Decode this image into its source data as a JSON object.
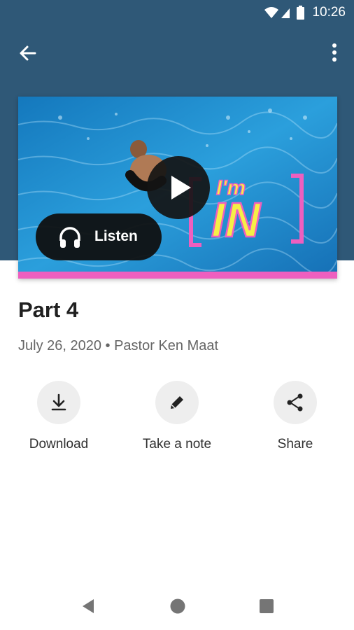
{
  "status_bar": {
    "time": "10:26"
  },
  "app_bar": {
    "back_icon": "arrow-left-icon",
    "more_icon": "more-vertical-icon"
  },
  "media": {
    "play_icon": "play-icon",
    "listen_label": "Listen",
    "listen_icon": "headphones-icon",
    "artwork_text_top": "I'm",
    "artwork_text_main": "IN",
    "accent_color": "#ee5fbf"
  },
  "episode": {
    "title": "Part 4",
    "meta": "July 26, 2020 • Pastor Ken Maat"
  },
  "actions": [
    {
      "label": "Download",
      "icon": "download-icon"
    },
    {
      "label": "Take a note",
      "icon": "pencil-icon"
    },
    {
      "label": "Share",
      "icon": "share-icon"
    }
  ],
  "nav": {
    "back": "nav-back-icon",
    "home": "nav-home-icon",
    "recents": "nav-recents-icon"
  },
  "colors": {
    "header": "#2f5877",
    "artwork_pink": "#ee5fbf",
    "artwork_yellow": "#f6f046"
  }
}
